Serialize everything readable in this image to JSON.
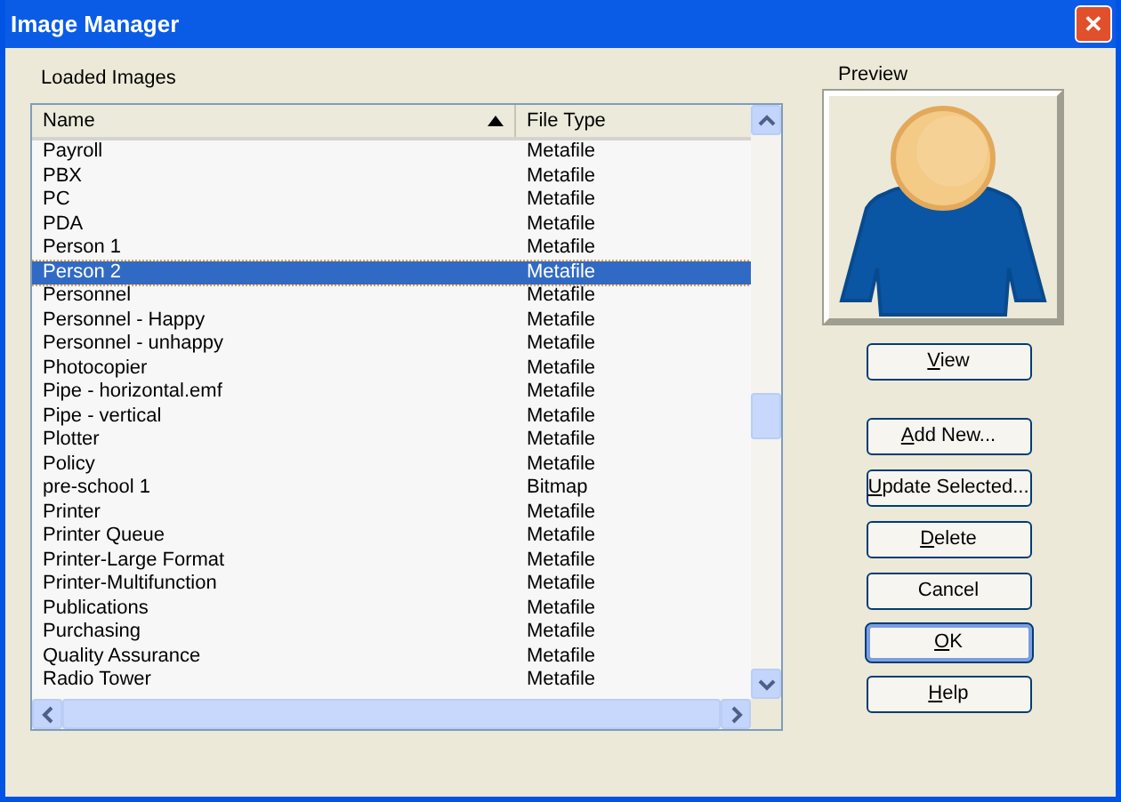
{
  "window": {
    "title": "Image Manager",
    "close": "✕"
  },
  "list": {
    "label": "Loaded Images",
    "columns": [
      {
        "label": "Name",
        "sorted": true
      },
      {
        "label": "File Type",
        "sorted": false
      }
    ],
    "rows": [
      {
        "name": "Payroll",
        "type": "Metafile",
        "selected": false
      },
      {
        "name": "PBX",
        "type": "Metafile",
        "selected": false
      },
      {
        "name": "PC",
        "type": "Metafile",
        "selected": false
      },
      {
        "name": "PDA",
        "type": "Metafile",
        "selected": false
      },
      {
        "name": "Person 1",
        "type": "Metafile",
        "selected": false
      },
      {
        "name": "Person 2",
        "type": "Metafile",
        "selected": true
      },
      {
        "name": "Personnel",
        "type": "Metafile",
        "selected": false
      },
      {
        "name": "Personnel - Happy",
        "type": "Metafile",
        "selected": false
      },
      {
        "name": "Personnel - unhappy",
        "type": "Metafile",
        "selected": false
      },
      {
        "name": "Photocopier",
        "type": "Metafile",
        "selected": false
      },
      {
        "name": "Pipe - horizontal.emf",
        "type": "Metafile",
        "selected": false
      },
      {
        "name": "Pipe - vertical",
        "type": "Metafile",
        "selected": false
      },
      {
        "name": "Plotter",
        "type": "Metafile",
        "selected": false
      },
      {
        "name": "Policy",
        "type": "Metafile",
        "selected": false
      },
      {
        "name": "pre-school 1",
        "type": "Bitmap",
        "selected": false
      },
      {
        "name": "Printer",
        "type": "Metafile",
        "selected": false
      },
      {
        "name": "Printer Queue",
        "type": "Metafile",
        "selected": false
      },
      {
        "name": "Printer-Large Format",
        "type": "Metafile",
        "selected": false
      },
      {
        "name": "Printer-Multifunction",
        "type": "Metafile",
        "selected": false
      },
      {
        "name": "Publications",
        "type": "Metafile",
        "selected": false
      },
      {
        "name": "Purchasing",
        "type": "Metafile",
        "selected": false
      },
      {
        "name": "Quality Assurance",
        "type": "Metafile",
        "selected": false
      },
      {
        "name": "Radio Tower",
        "type": "Metafile",
        "selected": false
      }
    ]
  },
  "preview": {
    "label": "Preview"
  },
  "view_button": {
    "key": "V",
    "rest": "iew",
    "default": false
  },
  "buttons": [
    {
      "key": "A",
      "rest": "dd New...",
      "default": false
    },
    {
      "key": "U",
      "rest": "pdate Selected...",
      "default": false
    },
    {
      "key": "D",
      "rest": "elete",
      "default": false
    },
    {
      "rest": "Cancel",
      "default": false
    },
    {
      "key": "O",
      "rest": "K",
      "default": true
    },
    {
      "key": "H",
      "rest": "elp",
      "default": false
    }
  ]
}
